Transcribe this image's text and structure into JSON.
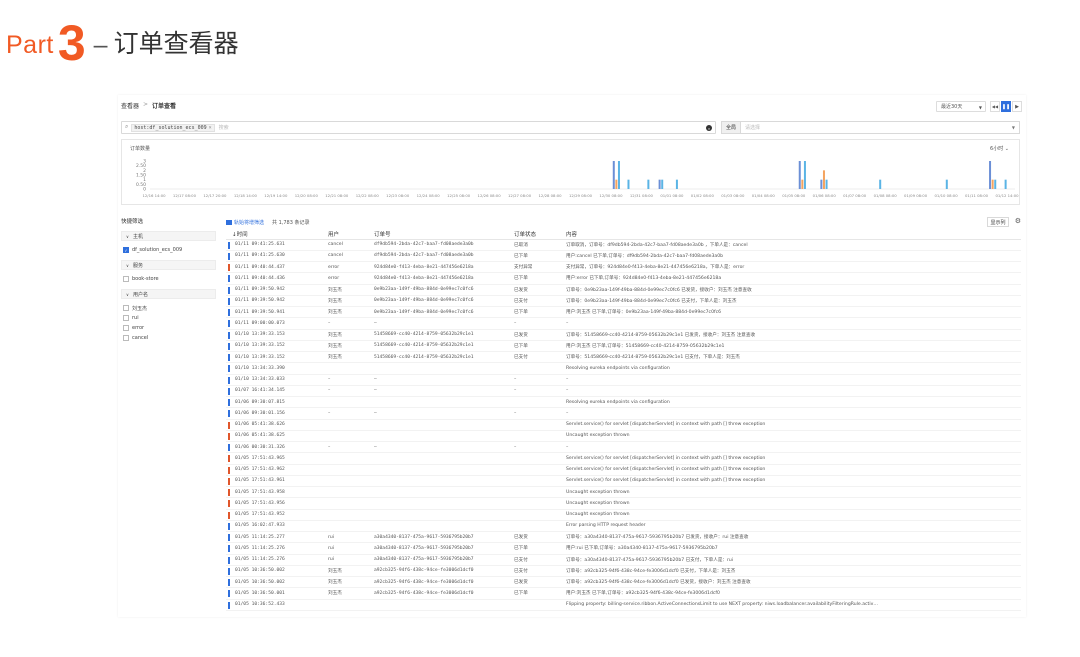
{
  "slide": {
    "part_word": "Part",
    "part_number": "3",
    "dash": "–",
    "title": "订单查看器",
    "accent_color": "#f15a24"
  },
  "app": {
    "breadcrumb": [
      "查看器",
      "订单查看"
    ],
    "breadcrumb_sep": ">",
    "time_range": "最近30天",
    "controls": [
      "◀◀",
      "❚❚",
      "▶"
    ],
    "search": {
      "tag": "host:df_solution_ecs_009",
      "placeholder": "搜索"
    },
    "field_filter": {
      "label": "全局",
      "placeholder": "请选择"
    }
  },
  "chart_data": {
    "type": "bar",
    "title": "订单数量",
    "interval": "6小时",
    "ylim": [
      0,
      3
    ],
    "yticks": [
      "3",
      "2.50",
      "2",
      "1.50",
      "1",
      "0.50",
      "0"
    ],
    "x_labels": [
      "12/16 14:00",
      "12/16 20:00",
      "12/17 08:00",
      "12/17 14:00",
      "12/17 20:00",
      "12/18 08:00",
      "12/18 14:00",
      "12/19 08:00",
      "12/19 14:00",
      "12/19 20:00",
      "12/20 08:00",
      "12/20 14:00",
      "12/20 20:00",
      "12/21 08:00",
      "12/21 14:00",
      "12/21 20:00",
      "12/22 08:00",
      "12/22 14:00",
      "12/22 20:00",
      "12/23 08:00",
      "12/23 14:00",
      "12/23 20:00",
      "12/24 08:00",
      "12/24 14:00",
      "12/24 20:00",
      "12/25 08:00",
      "12/25 14:00",
      "12/25 20:00",
      "12/26 08:00",
      "12/26 14:00",
      "12/26 20:00",
      "12/27 08:00",
      "12/27 14:00",
      "12/27 20:00",
      "12/28 08:00",
      "12/28 14:00",
      "12/28 20:00",
      "12/29 08:00",
      "12/29 14:00",
      "12/29 20:00",
      "12/30 08:00",
      "12/30 14:00",
      "12/30 20:00",
      "12/31 08:00",
      "12/31 14:00",
      "12/31 20:00",
      "01/01 08:00",
      "01/01 14:00",
      "01/01 20:00",
      "01/02 08:00",
      "01/02 14:00",
      "01/02 20:00",
      "01/03 08:00",
      "01/03 14:00",
      "01/03 20:00",
      "01/04 08:00",
      "01/04 14:00",
      "01/04 20:00",
      "01/05 08:00",
      "01/05 14:00",
      "01/05 20:00",
      "01/06 08:00",
      "01/06 14:00",
      "01/06 20:00",
      "01/07 08:00",
      "01/07 14:00",
      "01/07 20:00",
      "01/08 08:00",
      "01/08 14:00",
      "01/08 20:00",
      "01/09 08:00",
      "01/09 14:00",
      "01/09 20:00",
      "01/10 08:00",
      "01/10 14:00",
      "01/10 20:00",
      "01/11 08:00",
      "01/11 14:00",
      "01/11 20:00",
      "01/12 14:00"
    ],
    "x_ticks_shown": [
      "12/16 14:00",
      "12/16 20:00",
      "12/17 08:00",
      "12/17 14:00",
      "12/17 20:00",
      "12/18 08:00",
      "12/18 14:00",
      "12/19 08:00",
      "12/19 14:00",
      "12/19 20:00",
      "12/20 08:00",
      "12/20 14:00",
      "12/21 08:00",
      "12/21 14:00",
      "12/22 08:00",
      "12/22 14:00",
      "12/23 08:00",
      "12/23 14:00",
      "12/24 08:00",
      "12/24 14:00",
      "12/25 08:00",
      "12/25 14:00",
      "12/26 08:00",
      "12/26 14:00",
      "12/27 08:00",
      "12/27 14:00",
      "12/28 08:00",
      "12/28 14:00",
      "12/29 08:00",
      "12/29 14:00",
      "12/30 08:00",
      "12/30 14:00",
      "12/31 08:00",
      "12/31 14:00",
      "01/01 08:00",
      "01/01 14:00",
      "01/02 08:00",
      "01/02 14:00",
      "01/03 08:00",
      "01/03 14:00",
      "01/04 08:00",
      "01/04 14:00",
      "01/05 08:00",
      "01/05 14:00",
      "01/06 08:00",
      "01/06 14:00",
      "01/07 08:00",
      "01/07 14:00",
      "01/08 08:00",
      "01/08 14:00",
      "01/09 08:00",
      "01/09 14:00",
      "01/10 08:00",
      "01/10 14:00",
      "01/11 08:00",
      "01/11 14:00",
      "01/12 14:00"
    ],
    "series_colors": [
      "#6b8fd6",
      "#5ab4e5",
      "#f4a460"
    ],
    "bars": [
      {
        "t": 0.535,
        "values": [
          3,
          0,
          0
        ]
      },
      {
        "t": 0.538,
        "values": [
          0,
          0,
          1
        ]
      },
      {
        "t": 0.541,
        "values": [
          0,
          3,
          0
        ]
      },
      {
        "t": 0.552,
        "values": [
          0,
          1,
          0
        ]
      },
      {
        "t": 0.575,
        "values": [
          0,
          1,
          0
        ]
      },
      {
        "t": 0.588,
        "values": [
          1,
          0,
          0
        ]
      },
      {
        "t": 0.591,
        "values": [
          0,
          1,
          0
        ]
      },
      {
        "t": 0.608,
        "values": [
          0,
          1,
          0
        ]
      },
      {
        "t": 0.75,
        "values": [
          3,
          0,
          0
        ]
      },
      {
        "t": 0.753,
        "values": [
          0,
          0,
          1
        ]
      },
      {
        "t": 0.756,
        "values": [
          0,
          3,
          0
        ]
      },
      {
        "t": 0.775,
        "values": [
          1,
          0,
          0
        ]
      },
      {
        "t": 0.778,
        "values": [
          0,
          0,
          2
        ]
      },
      {
        "t": 0.781,
        "values": [
          0,
          1,
          0
        ]
      },
      {
        "t": 0.843,
        "values": [
          0,
          1,
          0
        ]
      },
      {
        "t": 0.92,
        "values": [
          0,
          1,
          0
        ]
      },
      {
        "t": 0.97,
        "values": [
          3,
          0,
          0
        ]
      },
      {
        "t": 0.973,
        "values": [
          0,
          0,
          1
        ]
      },
      {
        "t": 0.976,
        "values": [
          0,
          1,
          0
        ]
      },
      {
        "t": 0.988,
        "values": [
          0,
          1,
          0
        ]
      }
    ]
  },
  "filters": {
    "title": "快捷筛选",
    "groups": [
      {
        "label": "主机",
        "items": [
          {
            "label": "df_solution_ecs_009",
            "checked": true
          }
        ]
      },
      {
        "label": "服务",
        "items": [
          {
            "label": "book-store",
            "checked": false
          }
        ]
      },
      {
        "label": "用户名",
        "items": [
          {
            "label": "刘玉杰",
            "checked": false
          },
          {
            "label": "rui",
            "checked": false
          },
          {
            "label": "error",
            "checked": false
          },
          {
            "label": "cancel",
            "checked": false
          }
        ]
      }
    ]
  },
  "table": {
    "hint": "轨始将增筛选",
    "count": "共 1,783 条记录",
    "columns_button": "显示列",
    "gear": "⚙",
    "headers": [
      "时间",
      "用户",
      "订单号",
      "订单状态",
      "内容"
    ],
    "sort_marker": "↓",
    "level_colors": {
      "info": "#2f6fdd",
      "error": "#e0562c"
    },
    "rows": [
      {
        "level": "info",
        "time": "01/11 09:41:25.631",
        "user": "cancel",
        "order": "df9db594-2bda-42c7-baa7-fd08aede3a0b",
        "status": "已取消",
        "content": "订单取消，订单号：df9db594-2bda-42c7-baa7-fd08aede3a0b ，下单人是：cancel"
      },
      {
        "level": "info",
        "time": "01/11 09:41:25.630",
        "user": "cancel",
        "order": "df9db594-2bda-42c7-baa7-fd08aede3a0b",
        "status": "已下单",
        "content": "用户:cancel 已下单,订单号：df9db594-2bda-42c7-baa7-fd08aede3a0b"
      },
      {
        "level": "error",
        "time": "01/11 09:40:44.437",
        "user": "error",
        "order": "924d84e0-f413-4eba-8e21-447456e6218a",
        "status": "支付异常",
        "content": "支付异常，订单号：924d84e0-f413-4eba-8e21-447456e6218a，下单人是：error"
      },
      {
        "level": "info",
        "time": "01/11 09:40:44.436",
        "user": "error",
        "order": "924d84e0-f413-4eba-8e21-447456e6218a",
        "status": "已下单",
        "content": "用户:error 已下单,订单号：924d84e0-f413-4eba-8e21-447456e6218a"
      },
      {
        "level": "info",
        "time": "01/11 09:39:50.942",
        "user": "刘玉杰",
        "order": "0e9b23aa-149f-49ba-884d-0e99ec7c0fc6",
        "status": "已发货",
        "content": "订单号：0e9b23aa-149f-49ba-884d-0e99ec7c0fc6 已发货，接收户：刘玉杰 注意查收"
      },
      {
        "level": "info",
        "time": "01/11 09:39:50.942",
        "user": "刘玉杰",
        "order": "0e9b23aa-149f-49ba-884d-0e99ec7c0fc6",
        "status": "已支付",
        "content": "订单号：0e9b23aa-149f-49ba-884d-0e99ec7c0fc6 已支付，下单人是：刘玉杰"
      },
      {
        "level": "info",
        "time": "01/11 09:39:50.941",
        "user": "刘玉杰",
        "order": "0e9b23aa-149f-49ba-884d-0e99ec7c0fc6",
        "status": "已下单",
        "content": "用户:刘玉杰 已下单,订单号：0e9b23aa-149f-49ba-884d-0e99ec7c0fc6"
      },
      {
        "level": "info",
        "time": "01/11 09:00:00.073",
        "user": "–",
        "order": "–",
        "status": "–",
        "content": "–"
      },
      {
        "level": "info",
        "time": "01/10 13:39:33.153",
        "user": "刘玉杰",
        "order": "51458669-cc40-4214-8759-05632b29c1e1",
        "status": "已发货",
        "content": "订单号：51458669-cc40-4214-8759-05632b29c1e1 已发货，接收户：刘玉杰 注意查收"
      },
      {
        "level": "info",
        "time": "01/10 13:39:33.152",
        "user": "刘玉杰",
        "order": "51458669-cc40-4214-8759-05632b29c1e1",
        "status": "已下单",
        "content": "用户:刘玉杰 已下单,订单号：51458669-cc40-4214-8759-05632b29c1e1"
      },
      {
        "level": "info",
        "time": "01/10 13:39:33.152",
        "user": "刘玉杰",
        "order": "51458669-cc40-4214-8759-05632b29c1e1",
        "status": "已支付",
        "content": "订单号：51458669-cc40-4214-8759-05632b29c1e1 已支付，下单人是：刘玉杰"
      },
      {
        "level": "info",
        "time": "01/10 13:34:33.390",
        "user": "",
        "order": "",
        "status": "",
        "content": "Resolving eureka endpoints via configuration"
      },
      {
        "level": "info",
        "time": "01/10 13:34:33.033",
        "user": "–",
        "order": "–",
        "status": "–",
        "content": "–"
      },
      {
        "level": "info",
        "time": "01/07 16:41:34.145",
        "user": "–",
        "order": "–",
        "status": "–",
        "content": "–"
      },
      {
        "level": "info",
        "time": "01/06 09:30:07.815",
        "user": "",
        "order": "",
        "status": "",
        "content": "Resolving eureka endpoints via configuration"
      },
      {
        "level": "info",
        "time": "01/06 09:30:01.156",
        "user": "–",
        "order": "–",
        "status": "–",
        "content": "–"
      },
      {
        "level": "error",
        "time": "01/06 05:41:38.626",
        "user": "",
        "order": "",
        "status": "",
        "content": "Servlet.service() for servlet [dispatcherServlet] in context with path [] threw exception"
      },
      {
        "level": "error",
        "time": "01/06 05:41:38.625",
        "user": "",
        "order": "",
        "status": "",
        "content": "Uncaught exception thrown"
      },
      {
        "level": "info",
        "time": "01/06 00:30:31.326",
        "user": "–",
        "order": "–",
        "status": "–",
        "content": "–"
      },
      {
        "level": "error",
        "time": "01/05 17:51:43.965",
        "user": "",
        "order": "",
        "status": "",
        "content": "Servlet.service() for servlet [dispatcherServlet] in context with path [] threw exception"
      },
      {
        "level": "error",
        "time": "01/05 17:51:43.962",
        "user": "",
        "order": "",
        "status": "",
        "content": "Servlet.service() for servlet [dispatcherServlet] in context with path [] threw exception"
      },
      {
        "level": "error",
        "time": "01/05 17:51:43.961",
        "user": "",
        "order": "",
        "status": "",
        "content": "Servlet.service() for servlet [dispatcherServlet] in context with path [] threw exception"
      },
      {
        "level": "error",
        "time": "01/05 17:51:43.958",
        "user": "",
        "order": "",
        "status": "",
        "content": "Uncaught exception thrown"
      },
      {
        "level": "error",
        "time": "01/05 17:51:43.956",
        "user": "",
        "order": "",
        "status": "",
        "content": "Uncaught exception thrown"
      },
      {
        "level": "error",
        "time": "01/05 17:51:43.952",
        "user": "",
        "order": "",
        "status": "",
        "content": "Uncaught exception thrown"
      },
      {
        "level": "info",
        "time": "01/05 16:02:47.933",
        "user": "",
        "order": "",
        "status": "",
        "content": "Error parsing HTTP request header"
      },
      {
        "level": "info",
        "time": "01/05 11:14:25.277",
        "user": "rui",
        "order": "a30a4340-8137-475a-9617-5936795b20b7",
        "status": "已发货",
        "content": "订单号：a30a4340-8137-475a-9617-5936795b20b7 已发货，接收户：rui 注意查收"
      },
      {
        "level": "info",
        "time": "01/05 11:14:25.276",
        "user": "rui",
        "order": "a30a4340-8137-475a-9617-5936795b20b7",
        "status": "已下单",
        "content": "用户:rui 已下单,订单号：a30a4340-8137-475a-9617-5936795b20b7"
      },
      {
        "level": "info",
        "time": "01/05 11:14:25.276",
        "user": "rui",
        "order": "a30a4340-8137-475a-9617-5936795b20b7",
        "status": "已支付",
        "content": "订单号：a30a4340-8137-475a-9617-5936795b20b7 已支付，下单人是：rui"
      },
      {
        "level": "info",
        "time": "01/05 10:36:50.002",
        "user": "刘玉杰",
        "order": "a92cb325-94f6-438c-94ce-fe3006d1dcf0",
        "status": "已支付",
        "content": "订单号：a92cb325-94f6-438c-94ce-fe3006d1dcf0 已支付，下单人是：刘玉杰"
      },
      {
        "level": "info",
        "time": "01/05 10:36:50.002",
        "user": "刘玉杰",
        "order": "a92cb325-94f6-438c-94ce-fe3006d1dcf0",
        "status": "已发货",
        "content": "订单号：a92cb325-94f6-438c-94ce-fe3006d1dcf0 已发货，接收户：刘玉杰 注意查收"
      },
      {
        "level": "info",
        "time": "01/05 10:36:50.001",
        "user": "刘玉杰",
        "order": "a92cb325-94f6-438c-94ce-fe3006d1dcf0",
        "status": "已下单",
        "content": "用户:刘玉杰 已下单,订单号：a92cb325-94f6-438c-94ce-fe3006d1dcf0"
      },
      {
        "level": "info",
        "time": "01/05 10:36:52.433",
        "user": "",
        "order": "",
        "status": "",
        "content": "Flipping property: billing-service.ribbon.ActiveConnectionsLimit to use NEXT property: niws.loadbalancer.availabilityFilteringRule.activ…"
      }
    ]
  }
}
